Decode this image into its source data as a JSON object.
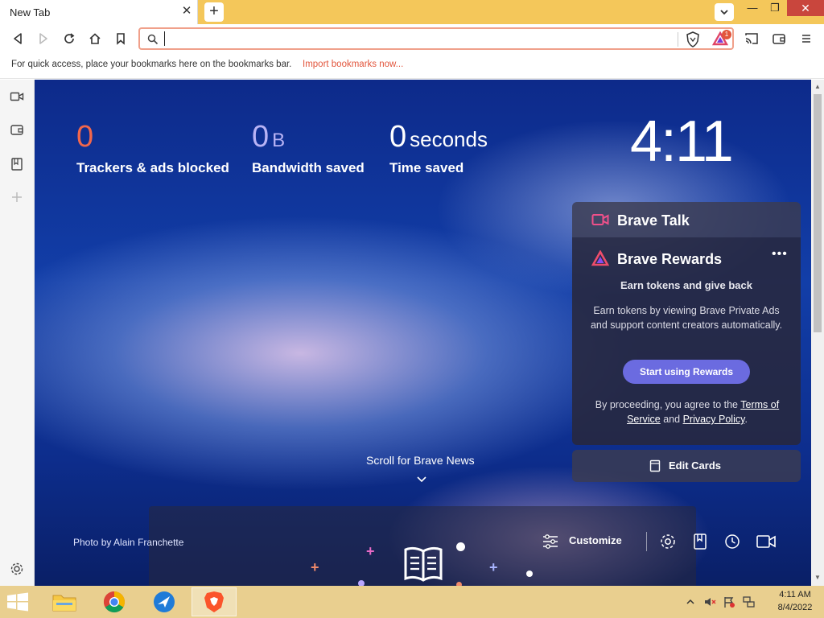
{
  "window": {
    "tab_title": "New Tab",
    "close_tab_glyph": "✕",
    "new_tab_glyph": "+",
    "minimize_glyph": "—",
    "maximize_glyph": "❐",
    "close_glyph": "✕"
  },
  "toolbar": {
    "url_value": "",
    "rewards_badge": "1"
  },
  "bookmarks_bar": {
    "hint": "For quick access, place your bookmarks here on the bookmarks bar.",
    "import_link": "Import bookmarks now..."
  },
  "stats": [
    {
      "value": "0",
      "unit": "",
      "label": "Trackers & ads blocked",
      "color": "#f2674c"
    },
    {
      "value": "0",
      "unit": "B",
      "label": "Bandwidth saved",
      "color": "#b8b3f5"
    },
    {
      "value": "0",
      "unit": "seconds",
      "label": "Time saved",
      "color": "#ffffff"
    }
  ],
  "clock": "4:11",
  "brave_talk": {
    "title": "Brave Talk"
  },
  "brave_rewards": {
    "title": "Brave Rewards",
    "menu": "•••",
    "subtitle": "Earn tokens and give back",
    "description": "Earn tokens by viewing Brave Private Ads and support content creators automatically.",
    "button": "Start using Rewards",
    "legal_prefix": "By proceeding, you agree to the ",
    "terms": "Terms of Service",
    "legal_and": " and ",
    "privacy": "Privacy Policy",
    "legal_suffix": "."
  },
  "edit_cards": "Edit Cards",
  "news": {
    "scroll_label": "Scroll for Brave News"
  },
  "photo_credit": {
    "prefix": "Photo by ",
    "author": "Alain Franchette"
  },
  "bottom_bar": {
    "customize": "Customize"
  },
  "taskbar": {
    "time": "4:11 AM",
    "date": "8/4/2022"
  },
  "colors": {
    "accent": "#f2674c",
    "rewards_button": "#6b6be0",
    "titlebar": "#f4c75a"
  }
}
